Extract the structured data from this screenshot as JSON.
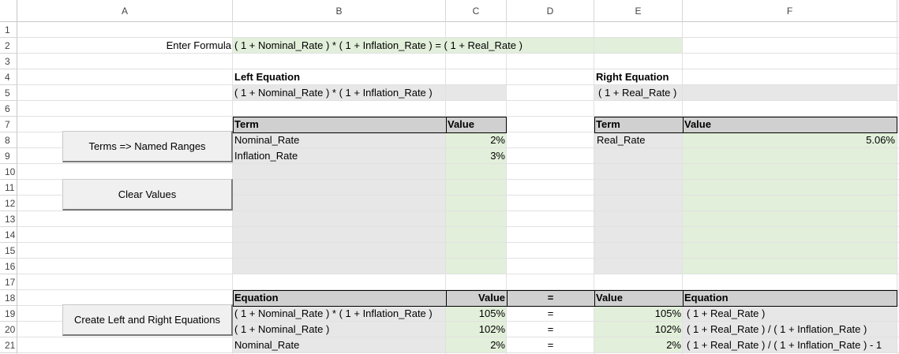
{
  "columns": [
    "A",
    "B",
    "C",
    "D",
    "E",
    "F"
  ],
  "rows": [
    "1",
    "2",
    "3",
    "4",
    "5",
    "6",
    "7",
    "8",
    "9",
    "10",
    "11",
    "12",
    "13",
    "14",
    "15",
    "16",
    "17",
    "18",
    "19",
    "20",
    "21"
  ],
  "formula": {
    "label": "Enter Formula",
    "value": "( 1 + Nominal_Rate ) * ( 1 + Inflation_Rate ) = ( 1 + Real_Rate )"
  },
  "left_equation": {
    "title": "Left Equation",
    "value": "( 1 + Nominal_Rate ) * ( 1 + Inflation_Rate )",
    "table_headers": {
      "term": "Term",
      "value": "Value"
    },
    "terms": [
      {
        "term": "Nominal_Rate",
        "value": "2%"
      },
      {
        "term": "Inflation_Rate",
        "value": "3%"
      }
    ]
  },
  "right_equation": {
    "title": "Right Equation",
    "value": "( 1 + Real_Rate )",
    "table_headers": {
      "term": "Term",
      "value": "Value"
    },
    "terms": [
      {
        "term": "Real_Rate",
        "value": "5.06%"
      }
    ]
  },
  "buttons": {
    "terms_named_ranges": "Terms => Named Ranges",
    "clear_values": "Clear Values",
    "create_equations": "Create Left and Right Equations"
  },
  "equations_table": {
    "headers": {
      "left_equation": "Equation",
      "left_value": "Value",
      "equals": "=",
      "right_value": "Value",
      "right_equation": "Equation"
    },
    "rows": [
      {
        "left_equation": "( 1 + Nominal_Rate ) * ( 1 + Inflation_Rate )",
        "left_value": "105%",
        "equals": "=",
        "right_value": "105%",
        "right_equation": "( 1 + Real_Rate )"
      },
      {
        "left_equation": "( 1 + Nominal_Rate )",
        "left_value": "102%",
        "equals": "=",
        "right_value": "102%",
        "right_equation": "( 1 + Real_Rate ) / ( 1 + Inflation_Rate )"
      },
      {
        "left_equation": "Nominal_Rate",
        "left_value": "2%",
        "equals": "=",
        "right_value": "2%",
        "right_equation": "( 1 + Real_Rate ) / ( 1 + Inflation_Rate ) - 1"
      }
    ]
  },
  "colors": {
    "input_green": "#e2efda",
    "output_gray": "#e7e7e7",
    "header_gray": "#d0d0d0"
  }
}
